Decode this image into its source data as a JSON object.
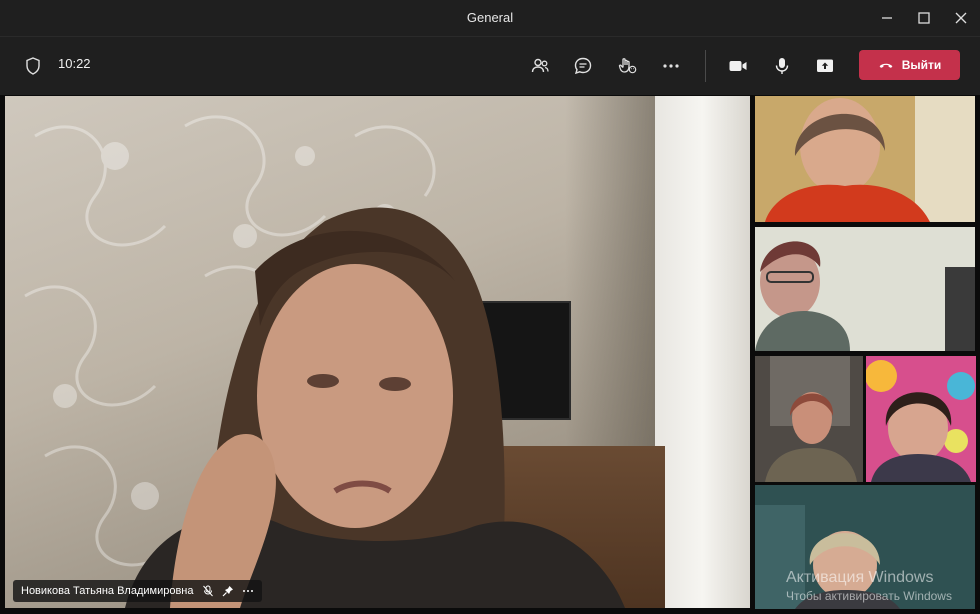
{
  "window": {
    "title": "General"
  },
  "toolbar": {
    "time": "10:22",
    "leave_label": "Выйти"
  },
  "main_video": {
    "participant_name": "Новикова Татьяна Владимировна"
  },
  "icons": {
    "shield": "shield-icon",
    "participants": "people-icon",
    "chat": "chat-icon",
    "reactions": "reactions-icon",
    "more": "more-icon",
    "camera": "camera-icon",
    "mic": "mic-icon",
    "share": "share-screen-icon",
    "hangup": "phone-hangup-icon"
  },
  "colors": {
    "leave": "#c4314b",
    "active_speaker_outline": "#6b6bd6",
    "titlebar": "#1f1f1f"
  },
  "watermark": {
    "line1": "Активация Windows",
    "line2": "Чтобы активировать Windows"
  }
}
